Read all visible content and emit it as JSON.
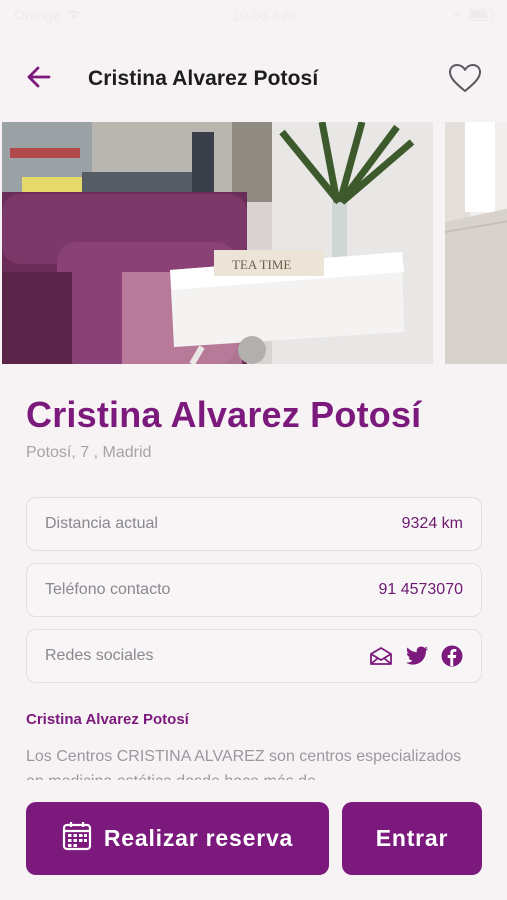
{
  "status_bar": {
    "carrier": "Orange",
    "time": "10:08 a.m."
  },
  "header": {
    "title": "Cristina Alvarez Potosí",
    "back_icon": "arrow-left-icon",
    "favorite_icon": "heart-outline-icon"
  },
  "gallery": {
    "photo_1_sign": "TEA TIME"
  },
  "place": {
    "name": "Cristina Alvarez Potosí",
    "address": "Potosí, 7 , Madrid"
  },
  "info": [
    {
      "label": "Distancia actual",
      "value": "9324 km"
    },
    {
      "label": "Teléfono contacto",
      "value": "91 4573070"
    },
    {
      "label": "Redes sociales",
      "icons": [
        "email-icon",
        "twitter-icon",
        "facebook-icon"
      ]
    }
  ],
  "description": {
    "title": "Cristina Alvarez Potosí",
    "text": "Los Centros CRISTINA ALVAREZ son centros especializados en medicina estética desde hace más de"
  },
  "actions": {
    "reserve_label": "Realizar reserva",
    "enter_label": "Entrar"
  },
  "colors": {
    "accent": "#7b1a7c",
    "background": "#f7f3f4"
  }
}
